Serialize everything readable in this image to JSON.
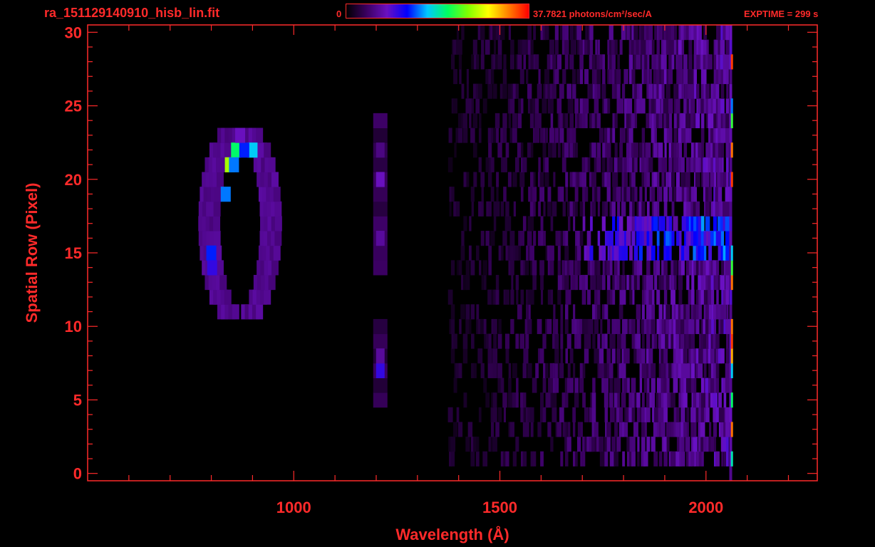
{
  "header": {
    "file_title": "ra_151129140910_hisb_lin.fit",
    "colorbar_min": "0",
    "colorbar_max_text": "37.7821 photons/cm²/sec/A",
    "exptime": "EXPTIME = 299 s"
  },
  "colors": {
    "axis": "#ff2a2a",
    "background": "#000000",
    "colormap": [
      "#000000",
      "#3a0060",
      "#6a10c0",
      "#0000ff",
      "#00c8ff",
      "#00ff60",
      "#80ff00",
      "#ffff00",
      "#ff8000",
      "#ff0000"
    ]
  },
  "chart_data": {
    "type": "heatmap",
    "xlabel": "Wavelength (Å)",
    "ylabel": "Spatial Row (Pixel)",
    "xlim": [
      500,
      2270
    ],
    "ylim": [
      -0.5,
      30.5
    ],
    "xticks": [
      1000,
      1500,
      2000
    ],
    "yticks": [
      0,
      5,
      10,
      15,
      20,
      25,
      30
    ],
    "colorbar": {
      "min": 0,
      "max": 37.7821,
      "unit": "photons/cm²/sec/A"
    },
    "features": {
      "ring": {
        "x_center": 870,
        "x_half_width": 75,
        "y_center": 17,
        "y_half_height": 6.5,
        "rows": [
          10,
          24
        ],
        "bright": [
          {
            "x": 860,
            "y": 22,
            "v": 0.55
          },
          {
            "x": 900,
            "y": 22,
            "v": 0.45
          },
          {
            "x": 880,
            "y": 22,
            "v": 0.35
          },
          {
            "x": 845,
            "y": 21,
            "v": 0.7
          },
          {
            "x": 855,
            "y": 21,
            "v": 0.4
          },
          {
            "x": 835,
            "y": 19,
            "v": 0.4
          },
          {
            "x": 800,
            "y": 15,
            "v": 0.35
          },
          {
            "x": 802,
            "y": 14,
            "v": 0.28
          },
          {
            "x": 870,
            "y": 23,
            "v": 0.22
          }
        ]
      },
      "line_1216": {
        "x": 1210,
        "rows": [
          5,
          24
        ],
        "v": 0.1,
        "bright": [
          {
            "y": 7,
            "v": 0.28
          },
          {
            "y": 8,
            "v": 0.18
          },
          {
            "y": 16,
            "v": 0.18
          },
          {
            "y": 20,
            "v": 0.22
          },
          {
            "y": 22,
            "v": 0.15
          }
        ]
      },
      "continuum": {
        "x_start": 1380,
        "x_end": 2055,
        "rows": [
          1,
          30
        ],
        "band_rows": [
          15,
          16,
          17
        ],
        "band_x_start": 1700,
        "v": 0.12
      },
      "edge": {
        "x": 2060,
        "rows": [
          0,
          30
        ],
        "bright": [
          {
            "y": 5,
            "v": 0.55
          },
          {
            "y": 7,
            "v": 0.45
          },
          {
            "y": 8,
            "v": 0.85
          },
          {
            "y": 9,
            "v": 0.95
          },
          {
            "y": 10,
            "v": 0.9
          },
          {
            "y": 13,
            "v": 0.9
          },
          {
            "y": 14,
            "v": 0.6
          },
          {
            "y": 15,
            "v": 0.45
          },
          {
            "y": 20,
            "v": 0.95
          },
          {
            "y": 22,
            "v": 0.9
          },
          {
            "y": 24,
            "v": 0.6
          },
          {
            "y": 28,
            "v": 0.95
          },
          {
            "y": 25,
            "v": 0.4
          },
          {
            "y": 3,
            "v": 0.9
          },
          {
            "y": 1,
            "v": 0.5
          }
        ]
      }
    }
  }
}
